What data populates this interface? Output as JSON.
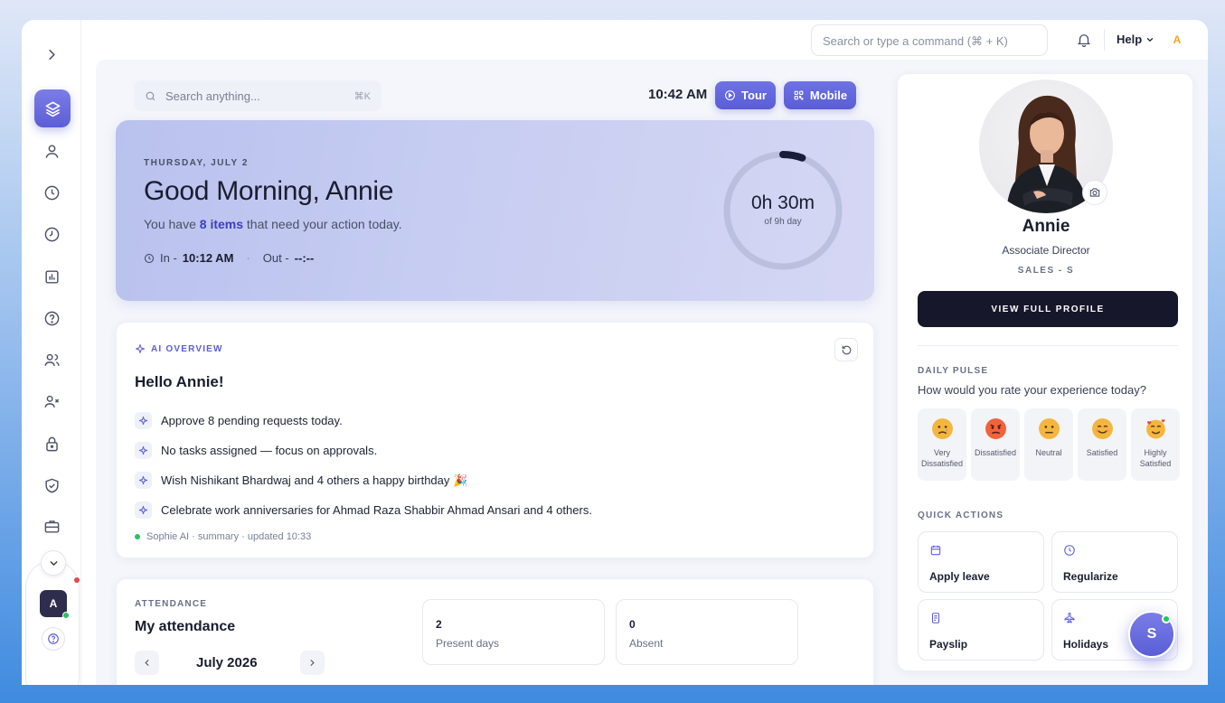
{
  "topbar": {
    "command_placeholder": "Search or type a command (⌘ + K)",
    "help_label": "Help",
    "avatar_initial": "A"
  },
  "rail": {
    "avatar_initial": "A",
    "icons": [
      "layers-icon",
      "user-icon",
      "clock-icon",
      "history-icon",
      "chart-icon",
      "question-icon",
      "users-icon",
      "user-remove-icon",
      "lock-icon",
      "shield-icon",
      "briefcase-icon"
    ]
  },
  "toolbar": {
    "search_placeholder": "Search anything...",
    "search_shortcut": "⌘K",
    "time": "10:42 AM",
    "tour_label": "Tour",
    "mobile_label": "Mobile"
  },
  "hero": {
    "date": "THURSDAY, JULY 2",
    "greeting": "Good Morning, Annie",
    "sub_prefix": "You have ",
    "sub_highlight": "8 items",
    "sub_suffix": " that need your action today.",
    "in_label": "In - ",
    "in_time": "10:12 AM",
    "out_label": "Out - ",
    "out_time": "--:--",
    "progress_value": "0h 30m",
    "progress_label": "of 9h day",
    "progress_fraction": 0.056
  },
  "ai": {
    "eyebrow": "AI OVERVIEW",
    "hello": "Hello Annie!",
    "items": [
      "Approve 8 pending requests today.",
      "No tasks assigned — focus on approvals.",
      "Wish Nishikant Bhardwaj and 4 others a happy birthday 🎉",
      "Celebrate work anniversaries for Ahmad Raza Shabbir Ahmad Ansari and 4 others."
    ],
    "footer": "Sophie AI · summary · updated 10:33"
  },
  "attendance": {
    "eyebrow": "ATTENDANCE",
    "title": "My attendance",
    "month": "July 2026",
    "present_value": "2",
    "present_label": "Present days",
    "absent_value": "0",
    "absent_label": "Absent"
  },
  "profile": {
    "name": "Annie",
    "role": "Associate Director",
    "dept": "SALES - S",
    "view_button": "VIEW FULL PROFILE"
  },
  "pulse": {
    "eyebrow": "DAILY PULSE",
    "question": "How would you rate your experience today?",
    "moods": [
      {
        "label": "Very Dissatisfied",
        "color": "#f4b63f"
      },
      {
        "label": "Dissatisfied",
        "color": "#f0633c"
      },
      {
        "label": "Neutral",
        "color": "#f4b63f"
      },
      {
        "label": "Satisfied",
        "color": "#f4b63f"
      },
      {
        "label": "Highly Satisfied",
        "color": "#f4b63f"
      }
    ]
  },
  "quick_actions": {
    "eyebrow": "QUICK ACTIONS",
    "apply_leave": "Apply leave",
    "regularize": "Regularize",
    "payslip": "Payslip",
    "holidays": "Holidays"
  },
  "assistant": {
    "initial": "S"
  },
  "colors": {
    "accent": "#5b5ed6",
    "dark": "#16172b",
    "online": "#22c55e"
  }
}
